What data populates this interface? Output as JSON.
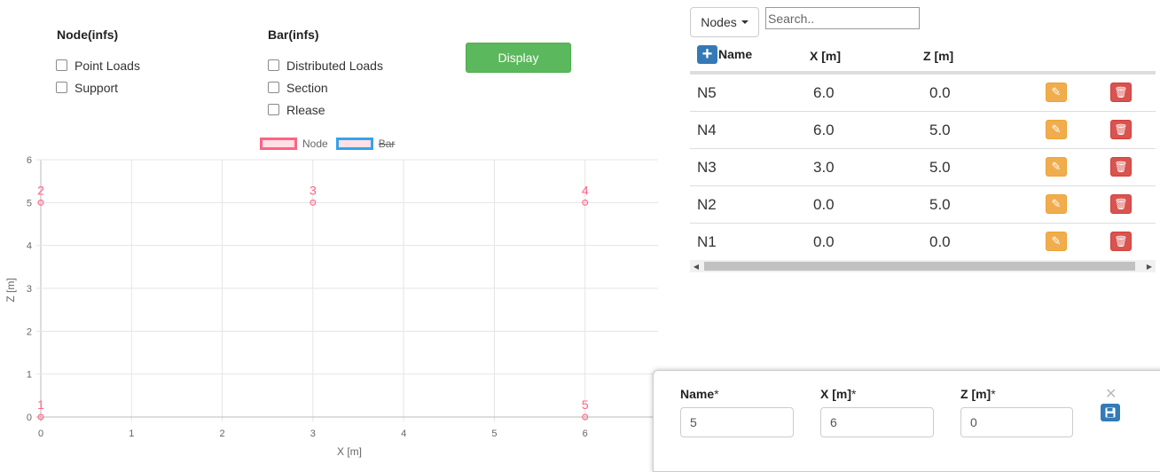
{
  "filters": {
    "node_group": {
      "title": "Node(infs)",
      "options": [
        "Point Loads",
        "Support"
      ]
    },
    "bar_group": {
      "title": "Bar(infs)",
      "options": [
        "Distributed Loads",
        "Section",
        "Rlease"
      ]
    },
    "display_label": "Display"
  },
  "legend": {
    "node_label": "Node",
    "bar_label": "Bar",
    "node_color": "#ff6384",
    "bar_color": "#36a2eb"
  },
  "chart_data": {
    "type": "scatter",
    "xlabel": "X [m]",
    "ylabel": "Z [m]",
    "xlim": [
      0,
      7
    ],
    "ylim": [
      0,
      6
    ],
    "x_ticks": [
      "0",
      "1",
      "2",
      "3",
      "4",
      "5",
      "6"
    ],
    "y_ticks": [
      "0",
      "1",
      "2",
      "3",
      "4",
      "5",
      "6"
    ],
    "grid": true,
    "legend_position": "top",
    "series": [
      {
        "name": "Node",
        "points": [
          {
            "label": "1",
            "x": 0,
            "y": 0
          },
          {
            "label": "2",
            "x": 0,
            "y": 5
          },
          {
            "label": "3",
            "x": 3,
            "y": 5
          },
          {
            "label": "4",
            "x": 6,
            "y": 5
          },
          {
            "label": "5",
            "x": 6,
            "y": 0
          }
        ]
      },
      {
        "name": "Bar",
        "hidden": true,
        "points": []
      }
    ]
  },
  "table": {
    "dropdown_label": "Nodes",
    "search_placeholder": "Search..",
    "headers": {
      "name": "Name",
      "x": "X [m]",
      "z": "Z [m]"
    },
    "add_icon": "plus-icon",
    "rows": [
      {
        "name": "N5",
        "x": "6.0",
        "z": "0.0"
      },
      {
        "name": "N4",
        "x": "6.0",
        "z": "5.0"
      },
      {
        "name": "N3",
        "x": "3.0",
        "z": "5.0"
      },
      {
        "name": "N2",
        "x": "0.0",
        "z": "5.0"
      },
      {
        "name": "N1",
        "x": "0.0",
        "z": "0.0"
      }
    ],
    "edit_icon": "pencil-icon",
    "delete_icon": "trash-icon"
  },
  "form": {
    "name_label": "Name",
    "x_label": "X [m]",
    "z_label": "Z [m]",
    "required_mark": "*",
    "name_value": "5",
    "x_value": "6",
    "z_value": "0",
    "close_icon": "close-icon",
    "save_icon": "save-icon"
  },
  "colors": {
    "display_button": "#5cb85c",
    "primary": "#337ab7",
    "edit": "#f0ad4e",
    "delete": "#d9534f"
  }
}
